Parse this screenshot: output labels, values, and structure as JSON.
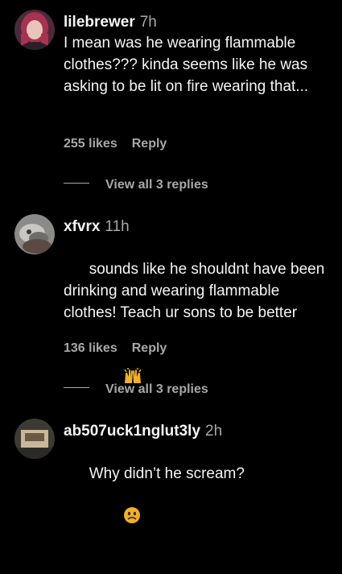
{
  "comments": [
    {
      "username": "lilebrewer",
      "time": "7h",
      "text": "I mean was he wearing flammable clothes??? kinda seems like he was asking to be lit on fire wearing that...",
      "likes": "255 likes",
      "reply": "Reply",
      "view_replies": "View all 3 replies"
    },
    {
      "username": "xfvrx",
      "time": "11h",
      "text": "sounds like he shouldnt have been drinking and wearing flammable clothes! Teach ur sons to be better",
      "emoji": "raising-hands-emoji",
      "likes": "136 likes",
      "reply": "Reply",
      "view_replies": "View all 3 replies"
    },
    {
      "username": "ab507uck1nglut3ly",
      "time": "2h",
      "text": "Why didn’t he scream?",
      "emoji": "frowning-face-emoji"
    }
  ],
  "colors": {
    "background": "#000000",
    "primary_text": "#f5f5f5",
    "secondary_text": "#a8a8a8"
  }
}
